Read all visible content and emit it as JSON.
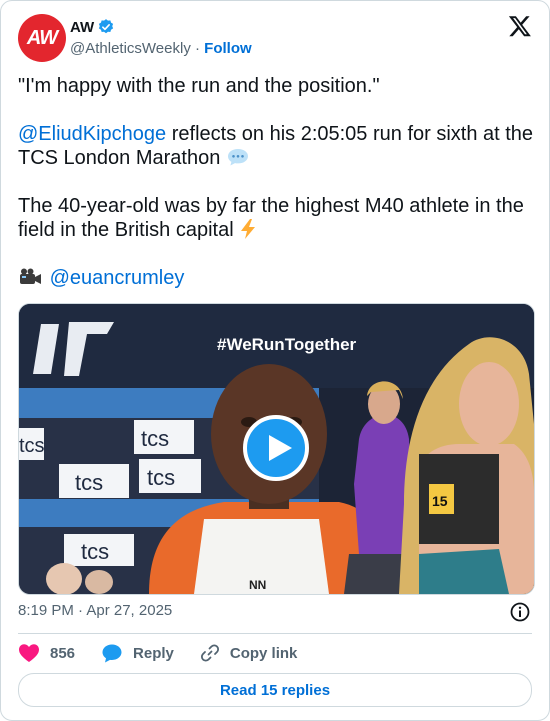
{
  "author": {
    "avatar_text": "AW",
    "name": "AW",
    "handle": "@AthleticsWeekly",
    "separator": "·",
    "follow_label": "Follow"
  },
  "tweet": {
    "line1": "\"I'm happy with the run and the position.\"",
    "mention": "@EliudKipchoge",
    "line2_rest": " reflects on his 2:05:05 run for sixth at the TCS London Marathon",
    "line3": "The 40-year-old was by far the highest M40 athlete in the field in the British capital",
    "credit_handle": "@euancrumley"
  },
  "media": {
    "hashtag": "#WeRunTogether",
    "backdrop_texts": [
      "tcs",
      "tcs",
      "tcs",
      "tcs",
      "tcs"
    ],
    "bib_number": "15",
    "kit_text": "NN"
  },
  "timestamp": "8:19 PM · Apr 27, 2025",
  "actions": {
    "likes_count": "856",
    "reply_label": "Reply",
    "copy_link_label": "Copy link"
  },
  "read_replies_label": "Read 15 replies",
  "colors": {
    "link": "#006fd6",
    "like": "#f91880",
    "reply_icon": "#1d9bf0",
    "avatar_bg": "#e3262e"
  }
}
